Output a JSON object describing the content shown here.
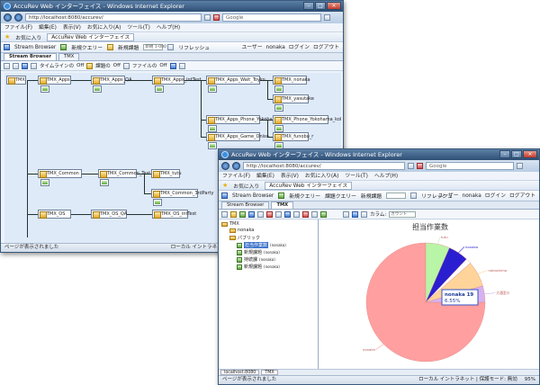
{
  "windows": {
    "back": {
      "title": "AccuRev Web インターフェイス - Windows Internet Explorer",
      "url": "http://localhost:8080/accurev/",
      "search_placeholder": "Google",
      "menu": [
        "ファイル(F)",
        "編集(E)",
        "表示(V)",
        "お気に入り(A)",
        "ツール(T)",
        "ヘルプ(H)"
      ],
      "favorites_label": "お気に入り",
      "page_tab": "AccuRev Web インターフェイス",
      "app_toolbar": {
        "stream_browser": "Stream Browser",
        "new_query": "新規クエリー",
        "new_issue": "新規課題",
        "issue_input": "新規 1-000",
        "refresh": "リフレッシュ",
        "user_label": "ユーザー",
        "user": "nonaka",
        "login": "ログイン",
        "logout": "ログアウト"
      },
      "stream_tabs": [
        "Stream Browser",
        "TMX"
      ],
      "sub_toolbar": {
        "timeline": "タイムラインの",
        "timeline_state": "Off",
        "issue": "課題の",
        "issue_state": "Off",
        "file": "ファイルの",
        "file_state": "Off"
      },
      "nodes": [
        "TMX",
        "TMX_Apps",
        "TMX_Apps_QA",
        "TMX_Apps_intTest",
        "TMX_Apps_Walt_Toyko",
        "TMX_nonaka",
        "TMX_yasutake",
        "TMX_Apps_Phone_Yokohama",
        "TMX_Phone_Yokohama_kobu",
        "TMX_Apps_Game_Oniso",
        "TMX_funobu_r",
        "TMX_Common",
        "TMX_Common_Test",
        "TMX_tutu",
        "TMX_Common_3rdParty",
        "TMX_OS",
        "TMX_OS_QA",
        "TMX_OS_intTest"
      ],
      "status": "ページが表示されました",
      "status_zone": "ローカル イントラネット"
    },
    "front": {
      "title": "AccuRev Web インターフェイス - Windows Internet Explorer",
      "url": "http://localhost:8080/accurev/",
      "search_placeholder": "Google",
      "menu": [
        "ファイル(F)",
        "編集(E)",
        "表示(V)",
        "お気に入り(A)",
        "ツール(T)",
        "ヘルプ(H)"
      ],
      "favorites_label": "お気に入り",
      "page_tab": "AccuRev Web インターフェイス",
      "app_toolbar": {
        "stream_browser": "Stream Browser",
        "new_query": "新規クエリー",
        "issue_query": "課題クエリー",
        "new_issue": "新規課題",
        "refresh": "リフレッシュ",
        "user_label": "ユーザー",
        "user": "nonaka",
        "login": "ログイン",
        "logout": "ログアウト"
      },
      "stream_tabs": [
        "Stream Browser",
        "TMX"
      ],
      "sub_toolbar": {
        "color_label": "カラム:",
        "color_value": "カウント"
      },
      "tree": {
        "root": "TMX",
        "user": "nonaka",
        "public": "パブリック",
        "items": [
          {
            "label": "担当作業数",
            "user": "(nonaka)"
          },
          {
            "label": "新規課題",
            "user": "(nonaka)"
          },
          {
            "label": "持続課",
            "user": "(nonaka)"
          },
          {
            "label": "新規課題",
            "user": "(nonaka)"
          }
        ]
      },
      "bottom_tabs": [
        "localhost:8080",
        "TMX"
      ],
      "status": "ページが表示されました",
      "status_zone": "ローカル イントラネット | 保護モード: 無効",
      "zoom": "95%"
    }
  },
  "chart_data": {
    "type": "pie",
    "title": "担当作業数",
    "slices": [
      {
        "name": "nonaka",
        "value": 75.0,
        "color": "#ff9f9f"
      },
      {
        "name": "tutu",
        "value": 6.55,
        "color": "#b8f5a6"
      },
      {
        "name": "",
        "value": 5.5,
        "color": "#2a1fd0"
      },
      {
        "name": "",
        "value": 1.5,
        "color": "#ffffff"
      },
      {
        "name": "",
        "value": 7.0,
        "color": "#ffd49a"
      },
      {
        "name": "",
        "value": 4.45,
        "color": "#d6b3f0"
      }
    ],
    "labels": [
      "nonaka",
      "tutu",
      "nonaka",
      "",
      "nakashima",
      "大通里川"
    ],
    "tooltip": {
      "name": "nonaka 19",
      "percent": "6.55%"
    }
  }
}
